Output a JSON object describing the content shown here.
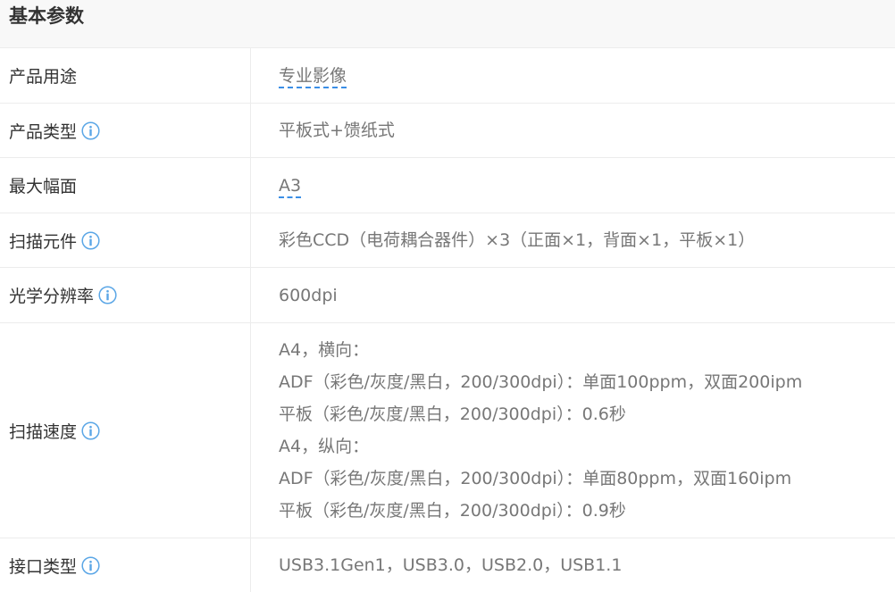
{
  "header": {
    "title": "基本参数"
  },
  "rows": [
    {
      "label": "产品用途",
      "lines": [
        "专业影像"
      ]
    },
    {
      "label": "产品类型",
      "lines": [
        "平板式+馈纸式"
      ]
    },
    {
      "label": "最大幅面",
      "lines": [
        "A3"
      ]
    },
    {
      "label": "扫描元件",
      "lines": [
        "彩色CCD（电荷耦合器件）×3（正面×1，背面×1，平板×1）"
      ]
    },
    {
      "label": "光学分辨率",
      "lines": [
        "600dpi"
      ]
    },
    {
      "label": "扫描速度",
      "lines": [
        "A4，横向：",
        "ADF（彩色/灰度/黑白，200/300dpi）：单面100ppm，双面200ipm",
        "平板（彩色/灰度/黑白，200/300dpi）：0.6秒",
        "A4，纵向：",
        "ADF（彩色/灰度/黑白，200/300dpi）：单面80ppm，双面160ipm",
        "平板（彩色/灰度/黑白，200/300dpi）：0.9秒"
      ]
    },
    {
      "label": "接口类型",
      "lines": [
        "USB3.1Gen1，USB3.0，USB2.0，USB1.1"
      ]
    }
  ],
  "colors": {
    "info_icon": "#5aa6e6",
    "link_underline": "#3a8ee6",
    "label_text": "#333333",
    "value_text": "#777777"
  },
  "icons": {
    "info": "info-circle-icon"
  }
}
